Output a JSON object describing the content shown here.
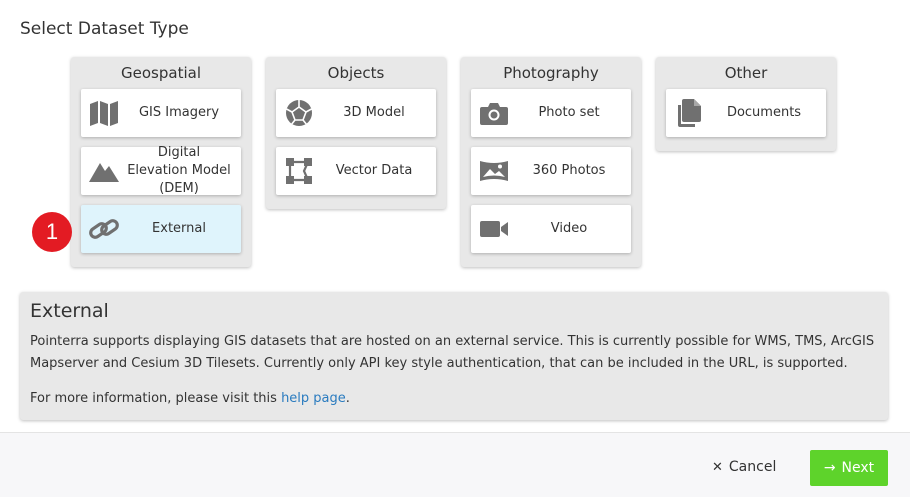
{
  "page": {
    "title": "Select Dataset Type"
  },
  "groups": [
    {
      "title": "Geospatial",
      "items": [
        {
          "label": "GIS Imagery",
          "icon": "map-icon"
        },
        {
          "label": "Digital Elevation Model (DEM)",
          "icon": "mountain-icon"
        },
        {
          "label": "External",
          "icon": "link-icon",
          "selected": true
        }
      ]
    },
    {
      "title": "Objects",
      "items": [
        {
          "label": "3D Model",
          "icon": "polyhedron-icon"
        },
        {
          "label": "Vector Data",
          "icon": "vector-icon"
        }
      ]
    },
    {
      "title": "Photography",
      "items": [
        {
          "label": "Photo set",
          "icon": "camera-icon"
        },
        {
          "label": "360 Photos",
          "icon": "panorama-icon"
        },
        {
          "label": "Video",
          "icon": "video-icon"
        }
      ]
    },
    {
      "title": "Other",
      "items": [
        {
          "label": "Documents",
          "icon": "documents-icon"
        }
      ]
    }
  ],
  "badge": {
    "text": "1",
    "color": "#e31b23"
  },
  "info": {
    "title": "External",
    "text": "Pointerra supports displaying GIS datasets that are hosted on an external service. This is currently possible for WMS, TMS, ArcGIS Mapserver and Cesium 3D Tilesets. Currently only API key style authentication, that can be included in the URL, is supported.",
    "more_prefix": "For more information, please visit this ",
    "more_link": "help page",
    "more_suffix": "."
  },
  "footer": {
    "cancel_label": "Cancel",
    "next_label": "Next"
  },
  "colors": {
    "accent_next": "#5ed32b",
    "selected_tile": "#dff4fc",
    "link": "#2a7bbf",
    "icon_gray": "#707070"
  }
}
